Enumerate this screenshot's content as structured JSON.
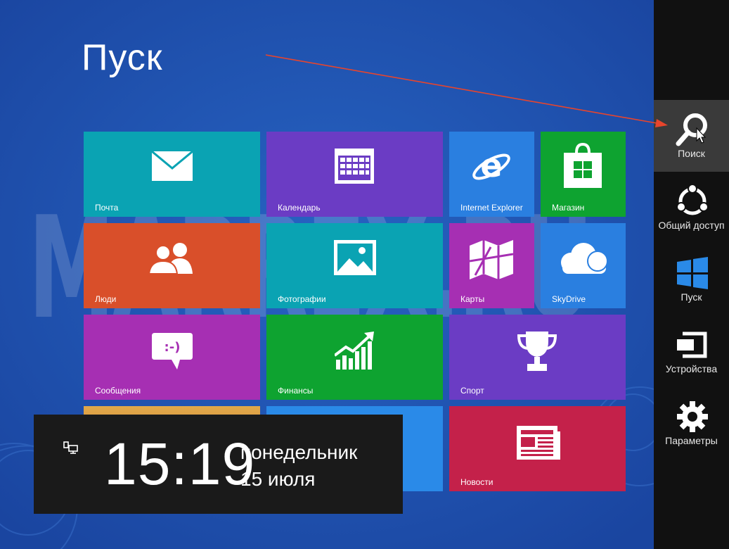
{
  "start": {
    "title": "Пуск"
  },
  "watermark": {
    "text": "MARREX.RU"
  },
  "tiles": {
    "mail": {
      "label": "Почта",
      "color": "#0aa3b3"
    },
    "calendar": {
      "label": "Календарь",
      "color": "#6b3cc4"
    },
    "ie": {
      "label": "Internet Explorer",
      "color": "#2a7fe0"
    },
    "store": {
      "label": "Магазин",
      "color": "#0ea330"
    },
    "people": {
      "label": "Люди",
      "color": "#d94f2a"
    },
    "photos": {
      "label": "Фотографии",
      "color": "#0aa3b3"
    },
    "maps": {
      "label": "Карты",
      "color": "#a62fb3"
    },
    "skydrive": {
      "label": "SkyDrive",
      "color": "#2a7fe0"
    },
    "messaging": {
      "label": "Сообщения",
      "color": "#a62fb3"
    },
    "finance": {
      "label": "Финансы",
      "color": "#0ea330"
    },
    "sport": {
      "label": "Спорт",
      "color": "#6b3cc4"
    },
    "news": {
      "label": "Новости",
      "color": "#c4214a"
    },
    "messaging_icon_text": ":-)"
  },
  "clock": {
    "time": "15:19",
    "day": "понедельник",
    "date": "15 июля"
  },
  "charms": {
    "search": {
      "label": "Поиск"
    },
    "share": {
      "label": "Общий доступ"
    },
    "start": {
      "label": "Пуск"
    },
    "devices": {
      "label": "Устройства"
    },
    "settings": {
      "label": "Параметры"
    }
  },
  "colors": {
    "background": "#1e4fa8",
    "charm_bar": "#111111",
    "annotation_arrow": "#e8452c"
  }
}
